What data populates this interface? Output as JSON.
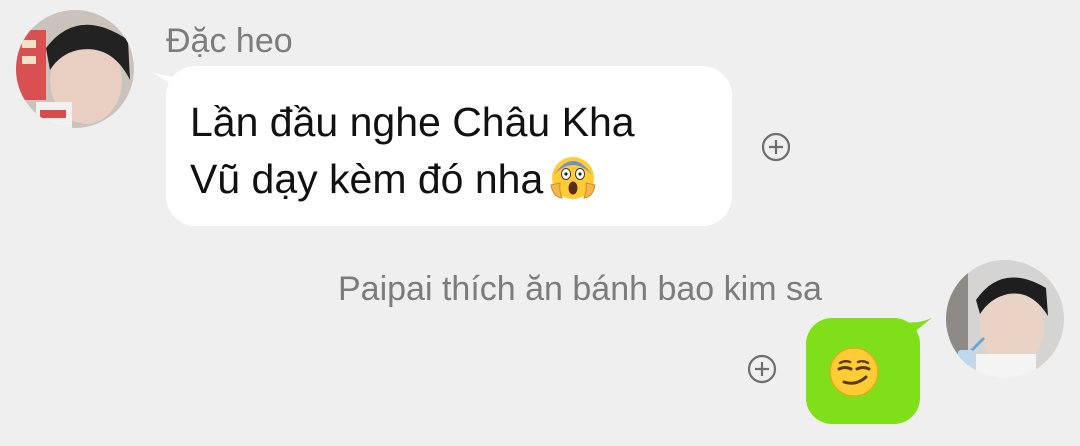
{
  "messages": [
    {
      "direction": "incoming",
      "sender": "Đặc heo",
      "lines": [
        "Lần đầu nghe Châu Kha",
        "Vũ dạy kèm đó nha"
      ],
      "emoji": "face-screaming-in-fear-icon",
      "bubble_color": "#ffffff"
    },
    {
      "direction": "outgoing",
      "sender": "Paipai thích ăn bánh bao kim sa",
      "emoji": "smirking-face-icon",
      "bubble_color": "#7fe01a"
    }
  ],
  "colors": {
    "background": "#efefef",
    "name_text": "#7c7c7c",
    "message_text": "#111111",
    "reaction_icon": "#6e6e6e"
  }
}
